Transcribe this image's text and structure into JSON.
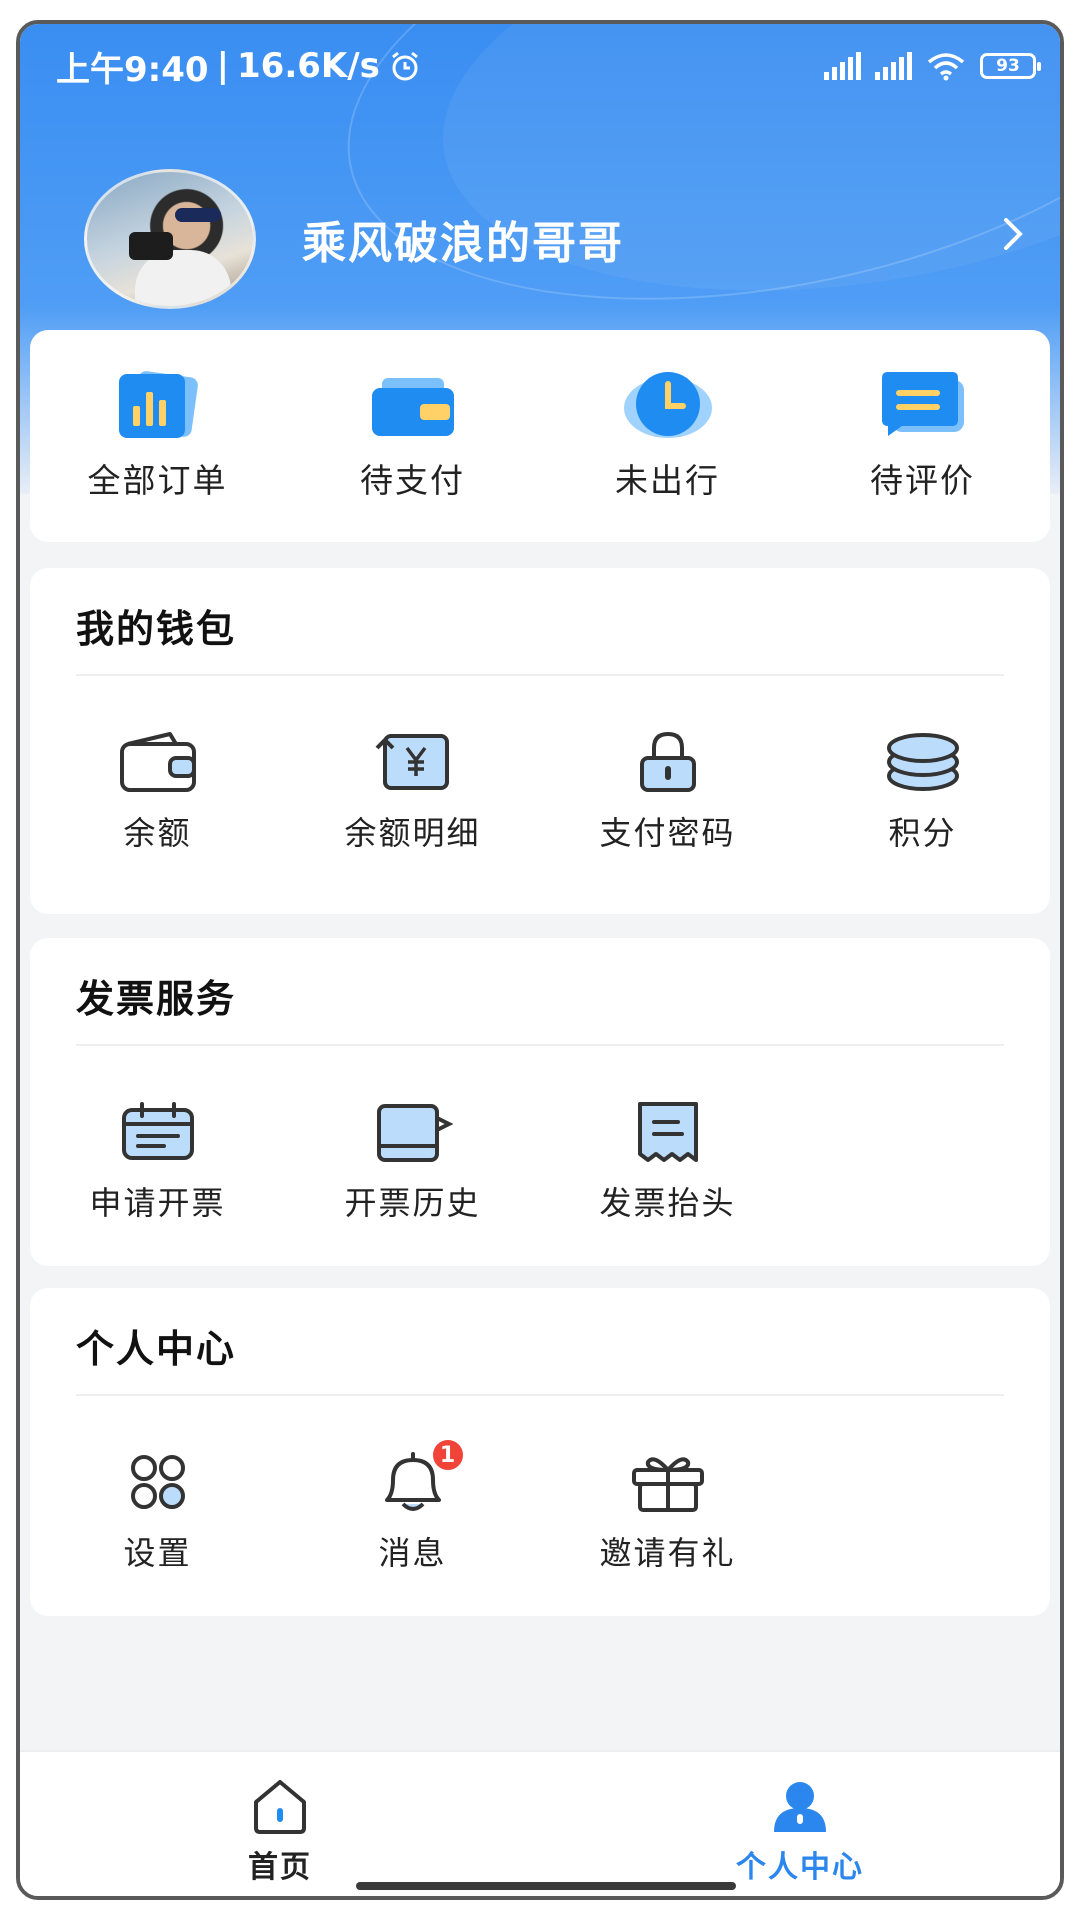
{
  "status_bar": {
    "time": "上午9:40",
    "speed": "16.6K/s",
    "battery": "93"
  },
  "profile": {
    "username": "乘风破浪的哥哥"
  },
  "orders": [
    {
      "label": "全部订单",
      "icon": "order-chart-icon"
    },
    {
      "label": "待支付",
      "icon": "wallet-card-icon"
    },
    {
      "label": "未出行",
      "icon": "clock-icon"
    },
    {
      "label": "待评价",
      "icon": "comment-icon"
    }
  ],
  "wallet": {
    "title": "我的钱包",
    "items": [
      {
        "label": "余额",
        "icon": "wallet-icon"
      },
      {
        "label": "余额明细",
        "icon": "yuan-refresh-icon"
      },
      {
        "label": "支付密码",
        "icon": "lock-icon"
      },
      {
        "label": "积分",
        "icon": "coins-icon"
      }
    ]
  },
  "invoice": {
    "title": "发票服务",
    "items": [
      {
        "label": "申请开票",
        "icon": "invoice-apply-icon"
      },
      {
        "label": "开票历史",
        "icon": "history-icon"
      },
      {
        "label": "发票抬头",
        "icon": "receipt-icon"
      }
    ]
  },
  "personal": {
    "title": "个人中心",
    "items": [
      {
        "label": "设置",
        "icon": "settings-grid-icon"
      },
      {
        "label": "消息",
        "icon": "bell-icon",
        "badge": "1"
      },
      {
        "label": "邀请有礼",
        "icon": "gift-icon"
      }
    ]
  },
  "tabbar": {
    "home": "首页",
    "me": "个人中心",
    "active_color": "#2b86ee"
  }
}
